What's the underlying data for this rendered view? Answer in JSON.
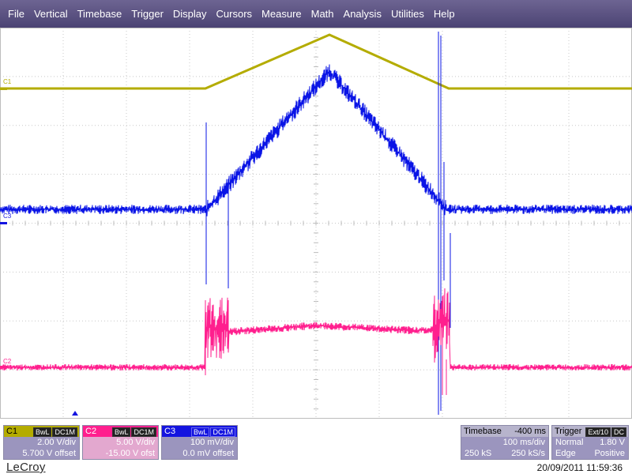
{
  "menu": [
    "File",
    "Vertical",
    "Timebase",
    "Trigger",
    "Display",
    "Cursors",
    "Measure",
    "Math",
    "Analysis",
    "Utilities",
    "Help"
  ],
  "traces": {
    "c1": {
      "label": "C1",
      "color": "#b4ac00"
    },
    "c2": {
      "label": "C2",
      "color": "#ff1f8e"
    },
    "c3": {
      "label": "C3",
      "color": "#0a14e6"
    }
  },
  "channels": [
    {
      "name": "C1",
      "badge1": "BwL",
      "badge2": "DC1M",
      "vdiv": "2.00 V/div",
      "offset": "5.700 V offset",
      "color": "#b4ac00",
      "body_bg": "#9b95be",
      "text_color": "#ffffff"
    },
    {
      "name": "C2",
      "badge1": "BwL",
      "badge2": "DC1M",
      "vdiv": "5.00 V/div",
      "offset": "-15.00 V ofst",
      "color": "#ff1f8e",
      "body_bg": "#e3a8cf",
      "text_color": "#ffffff"
    },
    {
      "name": "C3",
      "badge1": "BwL",
      "badge2": "DC1M",
      "vdiv": "100 mV/div",
      "offset": "0.0 mV offset",
      "color": "#1414e0",
      "body_bg": "#9b95be",
      "text_color": "#ffffff"
    }
  ],
  "timebase": {
    "label": "Timebase",
    "delay": "-400 ms",
    "tdiv": "100 ms/div",
    "samples": "250 kS",
    "rate": "250 kS/s"
  },
  "trigger": {
    "label": "Trigger",
    "badge1": "Ext/10",
    "badge2": "DC",
    "mode": "Normal",
    "level": "1.80 V",
    "type": "Edge",
    "slope": "Positive"
  },
  "footer": {
    "brand": "LeCroy",
    "datetime": "20/09/2011 11:59:36"
  }
}
